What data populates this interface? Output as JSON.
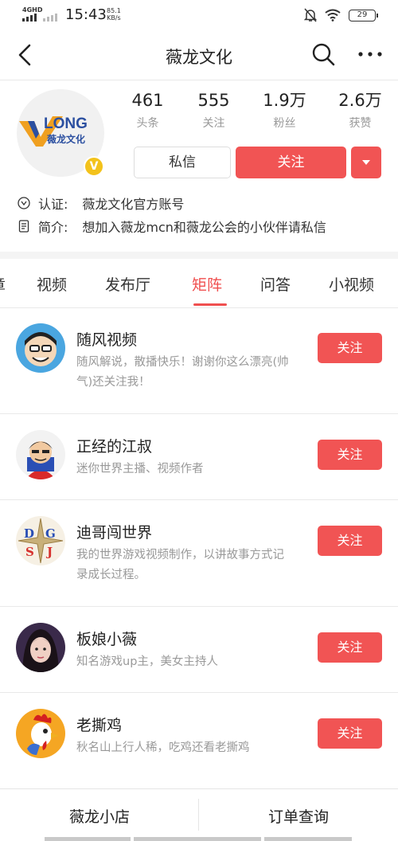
{
  "status_bar": {
    "network": "4GHD",
    "time": "15:43",
    "speed_value": "85.1",
    "speed_unit": "KB/s",
    "battery": "29"
  },
  "nav": {
    "title": "薇龙文化",
    "back_icon": "chevron-left-icon",
    "search_icon": "search-icon",
    "more_icon": "more-dots-icon"
  },
  "profile": {
    "logo_text": "LONG",
    "logo_sub": "薇龙文化",
    "badge": "V",
    "stats": [
      {
        "value": "461",
        "label": "头条"
      },
      {
        "value": "555",
        "label": "关注"
      },
      {
        "value": "1.9万",
        "label": "粉丝"
      },
      {
        "value": "2.6万",
        "label": "获赞"
      }
    ],
    "message_label": "私信",
    "follow_label": "关注",
    "verify_label": "认证:",
    "verify_text": "薇龙文化官方账号",
    "intro_label": "简介:",
    "intro_text": "想加入薇龙mcn和薇龙公会的小伙伴请私信"
  },
  "tabs": [
    {
      "label": "视频"
    },
    {
      "label": "发布厅"
    },
    {
      "label": "矩阵"
    },
    {
      "label": "问答"
    },
    {
      "label": "小视频"
    }
  ],
  "active_tab": "矩阵",
  "accounts": [
    {
      "name": "随风视频",
      "desc": "随风解说，散播快乐！谢谢你这么漂亮(帅气)还关注我！",
      "follow": "关注"
    },
    {
      "name": "正经的江叔",
      "desc": "迷你世界主播、视频作者",
      "follow": "关注"
    },
    {
      "name": "迪哥闯世界",
      "desc": "我的世界游戏视频制作，以讲故事方式记录成长过程。",
      "follow": "关注",
      "avatar_letters": [
        "D",
        "G",
        "S",
        "J"
      ]
    },
    {
      "name": "板娘小薇",
      "desc": "知名游戏up主，美女主持人",
      "follow": "关注"
    },
    {
      "name": "老撕鸡",
      "desc": "秋名山上行人稀，吃鸡还看老撕鸡",
      "follow": "关注"
    }
  ],
  "bottom": {
    "shop": "薇龙小店",
    "orders": "订单查询"
  },
  "colors": {
    "accent": "#f15454",
    "badge": "#f3c21b",
    "muted": "#999999"
  }
}
